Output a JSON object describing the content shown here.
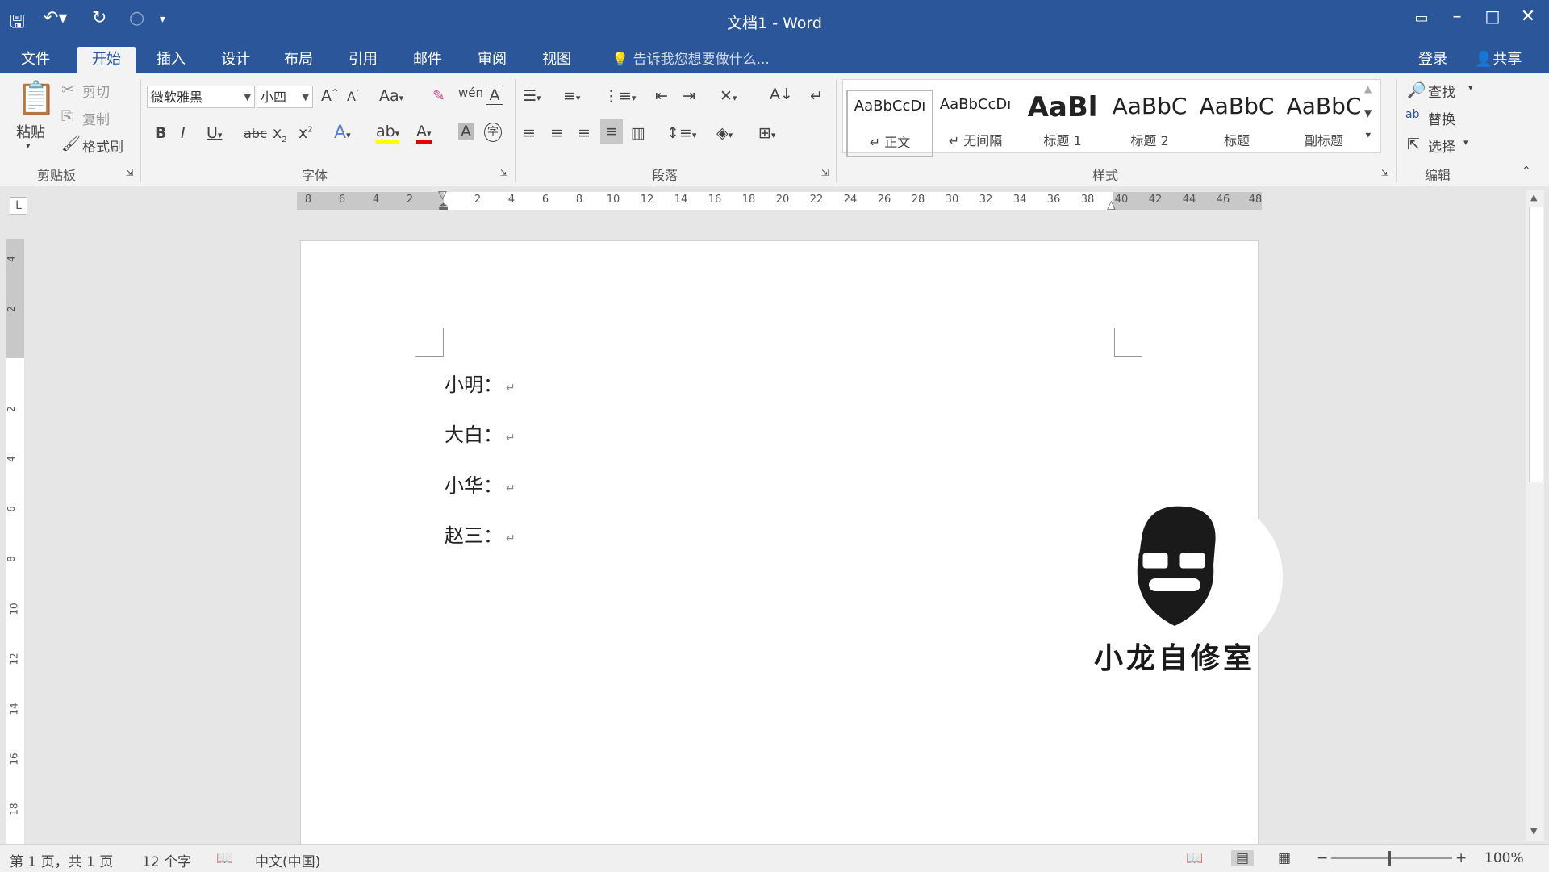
{
  "window": {
    "title": "文档1 - Word"
  },
  "tabs": [
    {
      "label": "文件"
    },
    {
      "label": "开始"
    },
    {
      "label": "插入"
    },
    {
      "label": "设计"
    },
    {
      "label": "布局"
    },
    {
      "label": "引用"
    },
    {
      "label": "邮件"
    },
    {
      "label": "审阅"
    },
    {
      "label": "视图"
    }
  ],
  "tell_me": {
    "placeholder": "告诉我您想要做什么..."
  },
  "account": {
    "login": "登录",
    "share": "共享"
  },
  "clipboard": {
    "paste": "粘贴",
    "cut": "剪切",
    "copy": "复制",
    "format_painter": "格式刷",
    "group": "剪贴板"
  },
  "font": {
    "name": "微软雅黑",
    "size": "小四",
    "group": "字体",
    "change_case": "Aa"
  },
  "paragraph": {
    "group": "段落"
  },
  "styles": {
    "group": "样式",
    "items": [
      {
        "preview": "AaBbCcDı",
        "name": "正文"
      },
      {
        "preview": "AaBbCcDı",
        "name": "无间隔"
      },
      {
        "preview": "AaBl",
        "name": "标题 1"
      },
      {
        "preview": "AaBbC",
        "name": "标题 2"
      },
      {
        "preview": "AaBbC",
        "name": "标题"
      },
      {
        "preview": "AaBbC",
        "name": "副标题"
      }
    ]
  },
  "editing": {
    "find": "查找",
    "replace": "替换",
    "select": "选择",
    "group": "编辑"
  },
  "ruler": {
    "ticks": [
      "8",
      "6",
      "4",
      "2",
      "2",
      "4",
      "6",
      "8",
      "10",
      "12",
      "14",
      "16",
      "18",
      "20",
      "22",
      "24",
      "26",
      "28",
      "30",
      "32",
      "34",
      "36",
      "38",
      "40",
      "42",
      "44",
      "46",
      "48"
    ],
    "vticks": [
      "4",
      "2",
      "2",
      "4",
      "6",
      "8",
      "10",
      "12",
      "14",
      "16",
      "18"
    ]
  },
  "document": {
    "paragraphs": [
      "小明：",
      "大白：",
      "小华：",
      "赵三："
    ]
  },
  "status": {
    "page": "第 1 页，共 1 页",
    "words": "12 个字",
    "lang": "中文(中国)",
    "zoom": "100%"
  },
  "logo": {
    "text": "小龙自修室"
  },
  "colors": {
    "accent": "#2b579a",
    "ribbon": "#f3f3f3",
    "highlight": "#ffff00",
    "font_color": "#e00000"
  }
}
